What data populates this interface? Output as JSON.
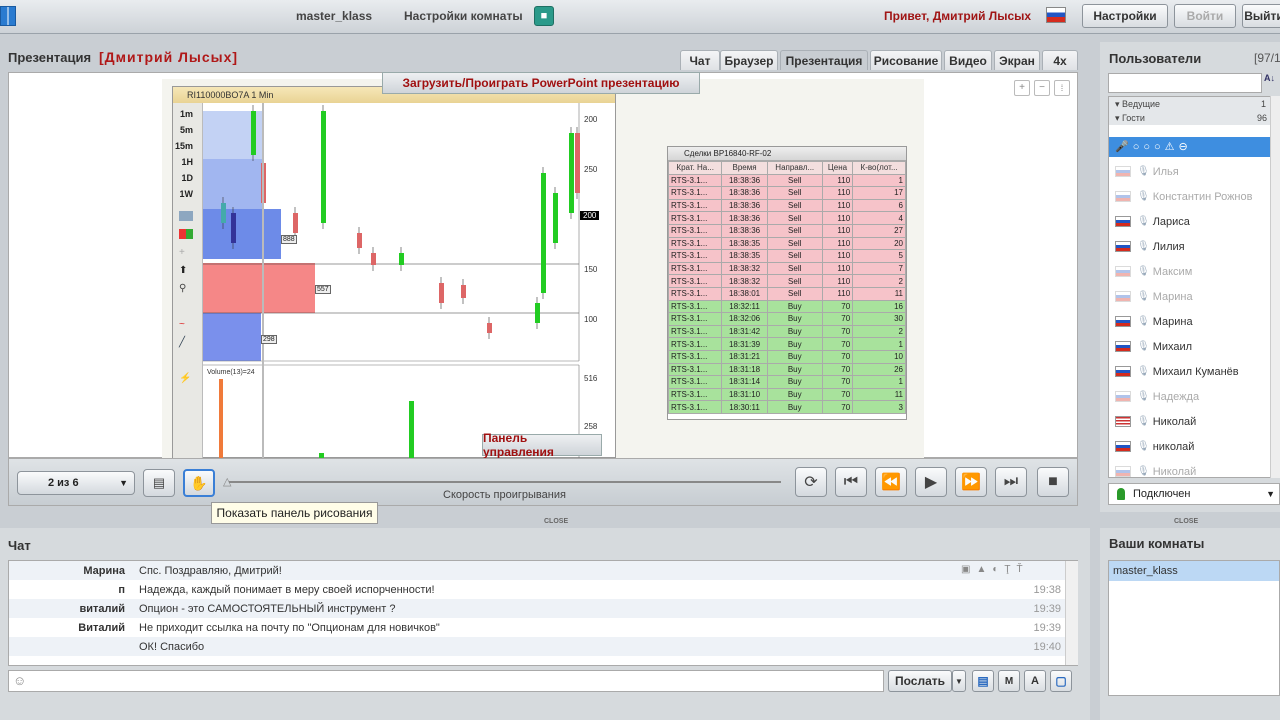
{
  "topbar": {
    "room": "master_klass",
    "room_settings": "Настройки комнаты",
    "greeting": "Привет, Дмитрий Лысых",
    "settings_btn": "Настройки",
    "login_btn": "Войти",
    "exit_btn": "Выйти"
  },
  "presentation": {
    "title": "Презентация",
    "presenter": "[Дмитрий Лысых]",
    "tabs": [
      "Чат",
      "Браузер",
      "Презентация",
      "Рисование",
      "Видео",
      "Экран",
      "4x"
    ],
    "active_tab": "Презентация",
    "upload_label": "Загрузить/Проиграть PowerPoint презентацию",
    "control_panel_label": "Панель управления",
    "page_select": "2 из 6",
    "speed_label": "Скорость проигрывания",
    "tooltip": "Показать панель рисования",
    "close": "CLOSE",
    "chart": {
      "title": "RI110000BO7A 1 Min",
      "timeframes": [
        "1m",
        "5m",
        "15m",
        "1H",
        "1D",
        "1W"
      ],
      "price_ticks": [
        "200",
        "250",
        "200",
        "150",
        "100"
      ],
      "volume_label": "Volume(13)=24",
      "vol_ticks": [
        "516",
        "258"
      ],
      "box_labels": [
        "888",
        "557",
        "298"
      ]
    },
    "trades": {
      "title": "Сделки  BP16840-RF-02",
      "headers": [
        "Крат. На...",
        "Время",
        "Направл...",
        "Цена",
        "К-во(лот..."
      ],
      "rows": [
        [
          "RTS-3.1...",
          "18:38:36",
          "Sell",
          "110",
          "1"
        ],
        [
          "RTS-3.1...",
          "18:38:36",
          "Sell",
          "110",
          "17"
        ],
        [
          "RTS-3.1...",
          "18:38:36",
          "Sell",
          "110",
          "6"
        ],
        [
          "RTS-3.1...",
          "18:38:36",
          "Sell",
          "110",
          "4"
        ],
        [
          "RTS-3.1...",
          "18:38:36",
          "Sell",
          "110",
          "27"
        ],
        [
          "RTS-3.1...",
          "18:38:35",
          "Sell",
          "110",
          "20"
        ],
        [
          "RTS-3.1...",
          "18:38:35",
          "Sell",
          "110",
          "5"
        ],
        [
          "RTS-3.1...",
          "18:38:32",
          "Sell",
          "110",
          "7"
        ],
        [
          "RTS-3.1...",
          "18:38:32",
          "Sell",
          "110",
          "2"
        ],
        [
          "RTS-3.1...",
          "18:38:01",
          "Sell",
          "110",
          "11"
        ],
        [
          "RTS-3.1...",
          "18:32:11",
          "Buy",
          "70",
          "16"
        ],
        [
          "RTS-3.1...",
          "18:32:06",
          "Buy",
          "70",
          "30"
        ],
        [
          "RTS-3.1...",
          "18:31:42",
          "Buy",
          "70",
          "2"
        ],
        [
          "RTS-3.1...",
          "18:31:39",
          "Buy",
          "70",
          "1"
        ],
        [
          "RTS-3.1...",
          "18:31:21",
          "Buy",
          "70",
          "10"
        ],
        [
          "RTS-3.1...",
          "18:31:18",
          "Buy",
          "70",
          "26"
        ],
        [
          "RTS-3.1...",
          "18:31:14",
          "Buy",
          "70",
          "1"
        ],
        [
          "RTS-3.1...",
          "18:31:10",
          "Buy",
          "70",
          "11"
        ],
        [
          "RTS-3.1...",
          "18:30:11",
          "Buy",
          "70",
          "3"
        ]
      ]
    }
  },
  "users": {
    "title": "Пользователи",
    "count": "[97/1...",
    "search_placeholder": "",
    "group_hosts": "Ведущие",
    "hosts_count": "1",
    "group_guests": "Гости",
    "guests_count": "96",
    "list": [
      {
        "name": "Илья",
        "online": false,
        "flag": "ru"
      },
      {
        "name": "Константин Рожнов",
        "online": false,
        "flag": "ru"
      },
      {
        "name": "Лариса",
        "online": true,
        "flag": "ru"
      },
      {
        "name": "Лилия",
        "online": true,
        "flag": "ru"
      },
      {
        "name": "Максим",
        "online": false,
        "flag": "ru"
      },
      {
        "name": "Марина",
        "online": false,
        "flag": "ru"
      },
      {
        "name": "Марина",
        "online": true,
        "flag": "ru"
      },
      {
        "name": "Михаил",
        "online": true,
        "flag": "ru"
      },
      {
        "name": "Михаил Куманёв",
        "online": true,
        "flag": "ru"
      },
      {
        "name": "Надежда",
        "online": false,
        "flag": "ru"
      },
      {
        "name": "Николай",
        "online": true,
        "flag": "us"
      },
      {
        "name": "николай",
        "online": true,
        "flag": "ru"
      },
      {
        "name": "Николай",
        "online": false,
        "flag": "ru"
      }
    ],
    "status": "Подключен"
  },
  "chat": {
    "title": "Чат",
    "messages": [
      {
        "who": "Марина",
        "text": "Спс. Поздравляю, Дмитрий!",
        "time": ""
      },
      {
        "who": "п",
        "text": "Надежда, каждый понимает в меру своей испорченности!",
        "time": "19:38"
      },
      {
        "who": "виталий",
        "text": "Опцион - это САМОСТОЯТЕЛЬНЫЙ инструмент ?",
        "time": "19:39"
      },
      {
        "who": "Виталий",
        "text": "Не приходит ссылка на почту по \"Опционам для новичков\"",
        "time": "19:39"
      },
      {
        "who": "",
        "text": "ОК! Спасибо",
        "time": "19:40"
      }
    ],
    "send_btn": "Послать",
    "input_placeholder": ""
  },
  "rooms": {
    "title": "Ваши комнаты",
    "items": [
      "master_klass"
    ]
  }
}
